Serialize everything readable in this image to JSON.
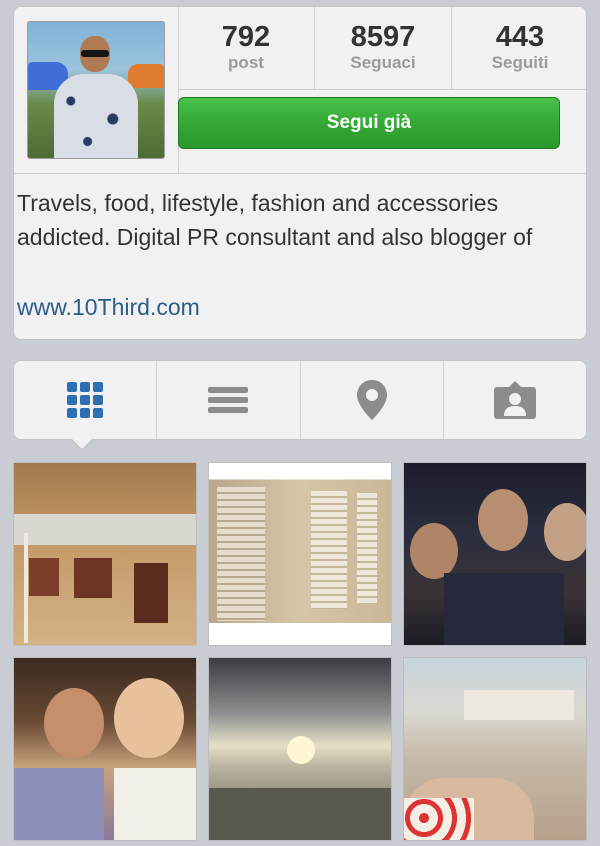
{
  "profile": {
    "avatar_alt": "",
    "stats": [
      {
        "value": "792",
        "label": "post"
      },
      {
        "value": "8597",
        "label": "Seguaci"
      },
      {
        "value": "443",
        "label": "Seguiti"
      }
    ],
    "follow_label": "Segui già",
    "follow_color": "#34a835",
    "bio": "Travels, food, lifestyle, fashion and accessories addicted. Digital PR consultant and also blogger of",
    "link": "www.10Third.com",
    "link_color": "#2a5d8a"
  },
  "tabs": [
    {
      "icon": "grid-icon",
      "active": true
    },
    {
      "icon": "list-icon",
      "active": false
    },
    {
      "icon": "location-pin-icon",
      "active": false
    },
    {
      "icon": "tagged-person-icon",
      "active": false
    }
  ],
  "photos": [
    {
      "subject": "beach-umbrellas"
    },
    {
      "subject": "beach-cabins"
    },
    {
      "subject": "friends-night"
    },
    {
      "subject": "couple-kiss"
    },
    {
      "subject": "sunset-sea"
    },
    {
      "subject": "beach-feet"
    }
  ]
}
